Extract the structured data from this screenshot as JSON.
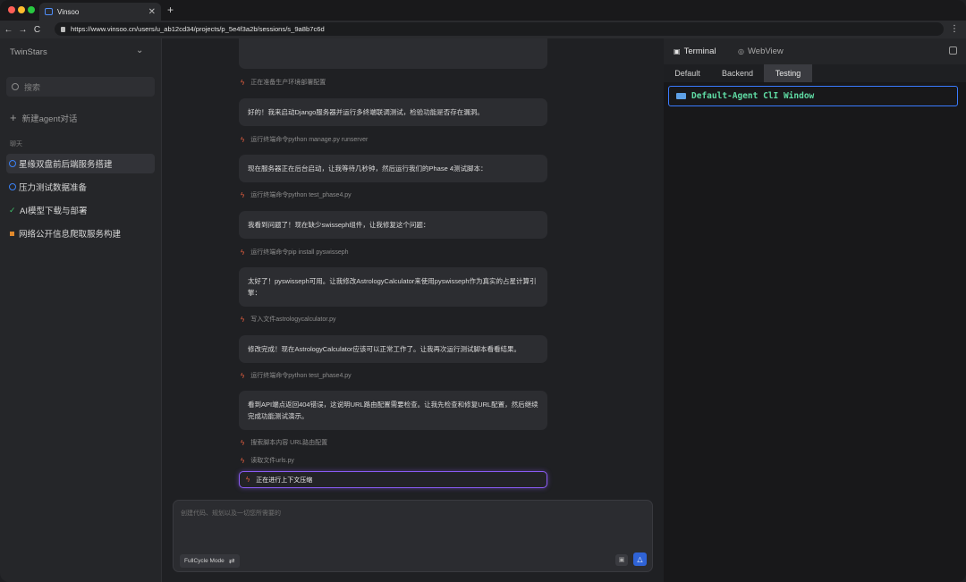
{
  "browser": {
    "tab_title": "Vinsoo",
    "tab_close": "✕",
    "new_tab": "+",
    "url": "https://www.vinsoo.cn/users/u_ab12cd34/projects/p_5e4f3a2b/sessions/s_9a8b7c6d",
    "back": "←",
    "forward": "→",
    "reload": "C",
    "menu": "⋮"
  },
  "sidebar": {
    "brand": "TwinStars",
    "chevron": "⌄",
    "search_placeholder": "搜索",
    "new_agent": "新建agent对话",
    "section_label": "聊天",
    "items": [
      {
        "label": "星缘双盘前后端服务搭建",
        "status_icon": "ring-icon",
        "active": true
      },
      {
        "label": "压力测试数据准备",
        "status_icon": "ring-icon",
        "active": false
      },
      {
        "label": "AI模型下载与部署",
        "status_icon": "check-icon",
        "active": false
      },
      {
        "label": "网络公开信息爬取服务构建",
        "status_icon": "square-icon",
        "active": false
      }
    ]
  },
  "chat": {
    "top_action": "正在准备生产环境部署配置",
    "messages": [
      {
        "text": "好的！我来启动Django服务器并运行多终端联调测试，检验功能是否存在漏洞。",
        "action": "运行终端命令python manage.py runserver"
      },
      {
        "text": "现在服务器正在后台启动，让我等待几秒钟，然后运行我们的Phase 4测试脚本：",
        "action": "运行终端命令python test_phase4.py"
      },
      {
        "text": "我看到问题了！现在缺少swisseph组件，让我修复这个问题：",
        "action": "运行终端命令pip install pyswisseph"
      },
      {
        "text": "太好了！pyswisseph可用。让我修改AstrologyCalculator来使用pyswisseph作为真实的占星计算引擎：",
        "action": "写入文件astrologycalculator.py"
      },
      {
        "text": "修改完成！现在AstrologyCalculator应该可以正常工作了。让我再次运行测试脚本看看结果。",
        "action": "运行终端命令python test_phase4.py"
      },
      {
        "text": "看到API端点返回404错误，这说明URL路由配置需要检查。让我先检查和修复URL配置，然后继续完成功能测试演示。",
        "action": "搜索脚本内容 URL路由配置"
      }
    ],
    "extra_action": "读取文件urls.py",
    "active_action": "正在进行上下文压缩",
    "composer_placeholder": "创建代码、规划以及一切您所需要的",
    "mode_label": "FullCycle Mode",
    "mode_icon": "⇄",
    "image_icon": "▣",
    "send_icon": "△"
  },
  "right_panel": {
    "tabs": [
      {
        "label": "Terminal",
        "icon": "▣"
      },
      {
        "label": "WebView",
        "icon": "◎"
      }
    ],
    "subtabs": [
      "Default",
      "Backend",
      "Testing"
    ],
    "selected_subtab": "Testing",
    "terminal_window_title": "Default-Agent ClI Window"
  },
  "colors": {
    "accent_blue": "#3b82f6",
    "active_border": "#8b5cf6",
    "bolt": "#e15d3e",
    "terminal_text": "#5fdba4"
  }
}
